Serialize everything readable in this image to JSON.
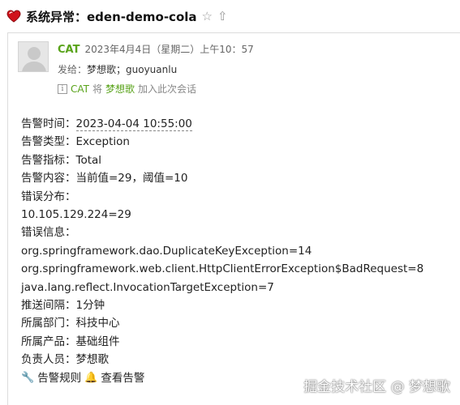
{
  "mail": {
    "subject_icon": "heart-icon",
    "subject": "系统异常：eden-demo-cola",
    "star_icon": "star-icon",
    "share_icon": "share-icon",
    "sender": "CAT",
    "sent_time": "2023年4月4日（星期二）上午10：57",
    "recipients_label": "发给：",
    "recipients": "梦想歌；guoyuanlu",
    "note_prefix": "CAT",
    "note_middle": "将",
    "note_name": "梦想歌",
    "note_action": "加入此次会话"
  },
  "alert": {
    "time_label": "告警时间：",
    "time_value": "2023-04-04 10:55:00",
    "type_line": "告警类型：Exception",
    "metric_line": "告警指标：Total",
    "content_line": "告警内容：当前值=29，阈值=10",
    "dist_label": "错误分布：",
    "dist_value": "10.105.129.224=29",
    "info_label": "错误信息：",
    "errors": [
      "org.springframework.dao.DuplicateKeyException=14",
      "org.springframework.web.client.HttpClientErrorException$BadRequest=8",
      "java.lang.reflect.InvocationTargetException=7"
    ],
    "interval_line": "推送间隔：1分钟",
    "dept_line": "所属部门：科技中心",
    "product_line": "所属产品：基础组件",
    "owner_line": "负责人员：梦想歌",
    "rules_link": "告警规则",
    "view_link": "查看告警"
  },
  "watermark": "掘金技术社区 @ 梦想歌"
}
